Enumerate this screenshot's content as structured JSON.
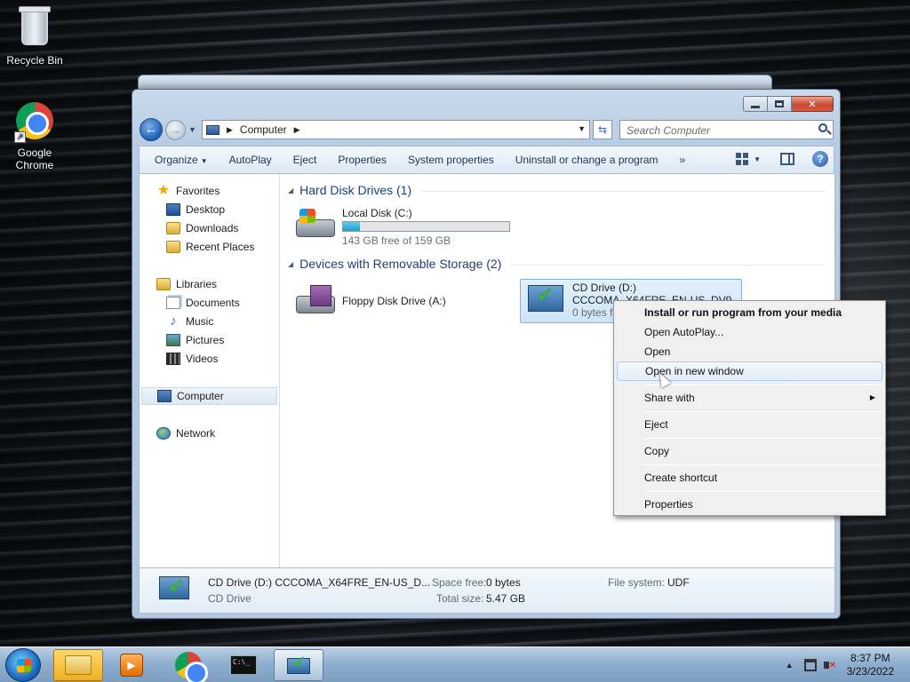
{
  "desktop": {
    "icons": [
      {
        "label": "Recycle Bin",
        "icon": "recycle-bin-icon"
      },
      {
        "label": "Google Chrome",
        "icon": "chrome-icon"
      }
    ]
  },
  "window": {
    "address": {
      "location": "Computer"
    },
    "search": {
      "placeholder": "Search Computer"
    },
    "toolbar": {
      "organize": "Organize",
      "autoplay": "AutoPlay",
      "eject": "Eject",
      "properties": "Properties",
      "system_properties": "System properties",
      "uninstall": "Uninstall or change a program",
      "more": "»"
    },
    "nav": {
      "favorites": "Favorites",
      "desktop": "Desktop",
      "downloads": "Downloads",
      "recent": "Recent Places",
      "libraries": "Libraries",
      "documents": "Documents",
      "music": "Music",
      "pictures": "Pictures",
      "videos": "Videos",
      "computer": "Computer",
      "network": "Network"
    },
    "groups": {
      "hdd": "Hard Disk Drives (1)",
      "removable": "Devices with Removable Storage (2)"
    },
    "drives": {
      "c": {
        "name": "Local Disk (C:)",
        "free": "143 GB free of 159 GB",
        "used_fraction": 0.1
      },
      "a": {
        "name": "Floppy Disk Drive (A:)"
      },
      "d": {
        "name": "CD Drive (D:)",
        "label": "CCCOMA_X64FRE_EN-US_DV9",
        "free": "0 bytes free of 5.47 GB"
      }
    },
    "details": {
      "title": "CD Drive (D:) CCCOMA_X64FRE_EN-US_D...",
      "type": "CD Drive",
      "space_free_label": "Space free:",
      "space_free": "0 bytes",
      "total_size_label": "Total size:",
      "total_size": "5.47 GB",
      "fs_label": "File system:",
      "fs": "UDF"
    }
  },
  "context_menu": {
    "items": [
      "Install or run program from your media",
      "Open AutoPlay...",
      "Open",
      "Open in new window",
      "Share with",
      "Eject",
      "Copy",
      "Create shortcut",
      "Properties"
    ]
  },
  "taskbar": {
    "time": "8:37 PM",
    "date": "3/23/2022"
  },
  "colors": {
    "accent": "#1e3f7a",
    "selection": "#cde4f7",
    "close_button": "#c94a31"
  }
}
